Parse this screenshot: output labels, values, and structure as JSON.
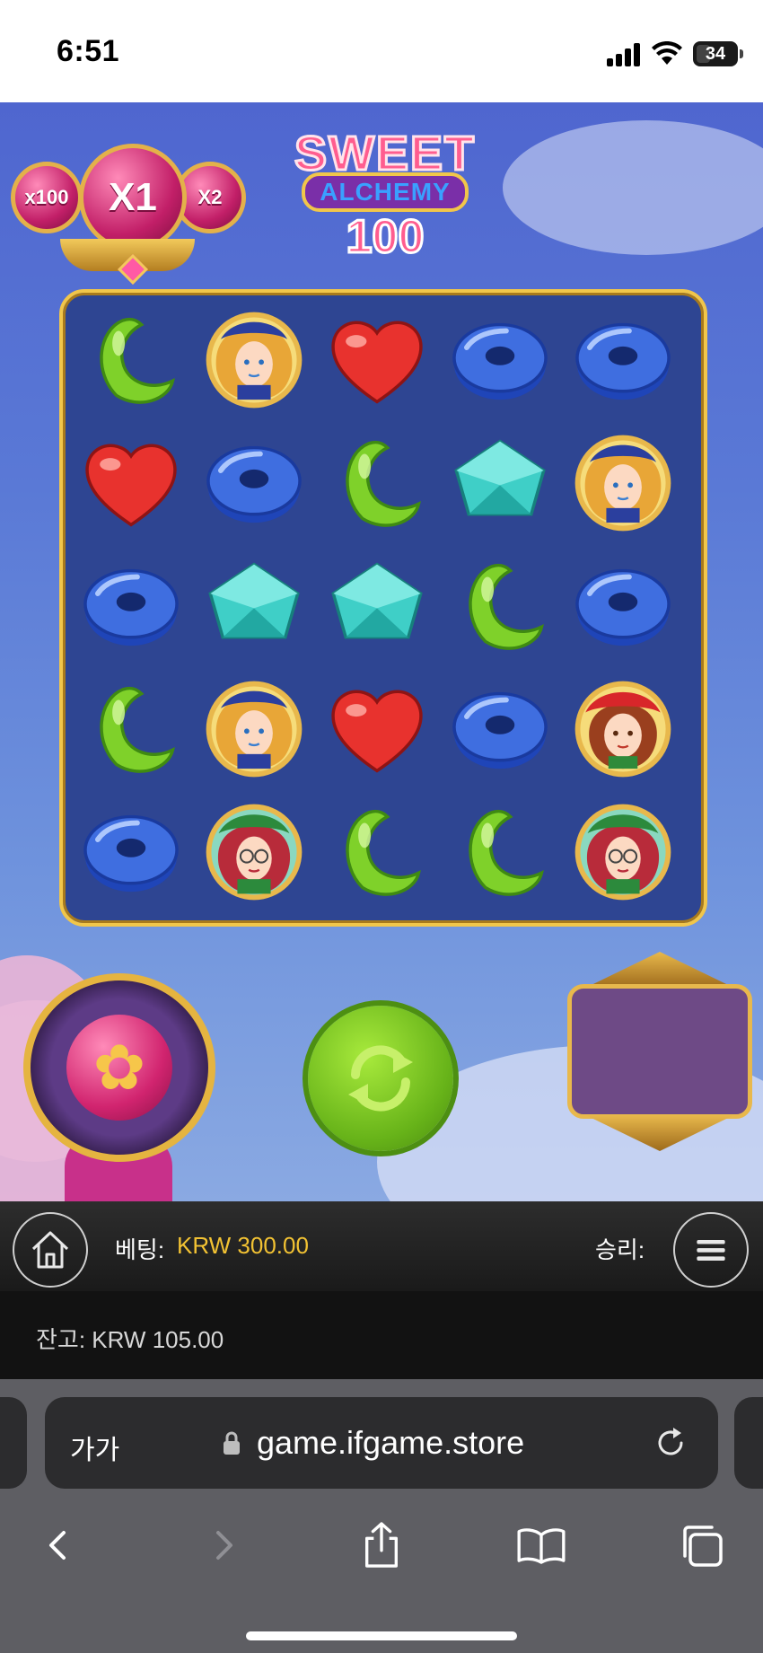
{
  "status_bar": {
    "time": "6:51",
    "battery": "34"
  },
  "game": {
    "multipliers": {
      "left": "x100",
      "main": "X1",
      "right": "X2"
    },
    "logo": {
      "line1": "SWEET",
      "line2": "ALCHEMY",
      "line3": "100"
    },
    "grid": [
      [
        "green-moon-candy",
        "blonde-witch-portrait",
        "red-heart-candy",
        "blue-donut-candy",
        "blue-donut-candy"
      ],
      [
        "red-heart-candy",
        "blue-donut-candy",
        "green-moon-candy",
        "teal-cube-candy",
        "blonde-witch-portrait"
      ],
      [
        "blue-donut-candy",
        "teal-cube-candy",
        "teal-cube-candy",
        "green-moon-candy",
        "blue-donut-candy"
      ],
      [
        "green-moon-candy",
        "blonde-witch-portrait",
        "red-heart-candy",
        "blue-donut-candy",
        "redhat-girl-portrait"
      ],
      [
        "blue-donut-candy",
        "green-witch-portrait",
        "green-moon-candy",
        "green-moon-candy",
        "green-witch-portrait"
      ]
    ],
    "colors": {
      "frame_gold": "#f1c64a",
      "grid_bg": "#2e4592",
      "spin_green": "#7cc324",
      "panel_purple": "#6e4a86"
    }
  },
  "info_bar": {
    "bet_label": "베팅:",
    "bet_value": "KRW 300.00",
    "win_label": "승리:"
  },
  "balance_bar": {
    "balance": "잔고: KRW 105.00"
  },
  "browser": {
    "text_size_label": "가가",
    "url": "game.ifgame.store"
  }
}
